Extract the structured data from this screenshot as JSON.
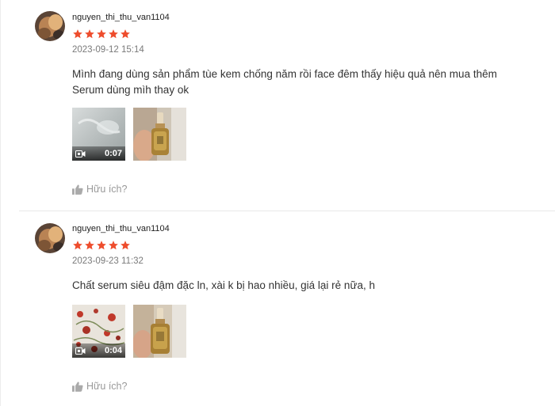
{
  "colors": {
    "star": "#ee4d2d",
    "muted": "#7a7a7a",
    "helpful": "#999999"
  },
  "reviews": [
    {
      "username": "nguyen_thi_thu_van1104",
      "rating": 5,
      "timestamp": "2023-09-12 15:14",
      "content": "Mình đang dùng sản phẩm tùe kem chống năm rồi face đêm thấy hiệu quả nên mua thêm Serum dùng mìh thay ok",
      "video_duration": "0:07",
      "helpful_label": "Hữu ích?"
    },
    {
      "username": "nguyen_thi_thu_van1104",
      "rating": 5,
      "timestamp": "2023-09-23 11:32",
      "content": "Chất serum siêu đậm đặc ln, xài k bị hao nhiều, giá lại rẻ nữa, h",
      "video_duration": "0:04",
      "helpful_label": "Hữu ích?"
    }
  ]
}
